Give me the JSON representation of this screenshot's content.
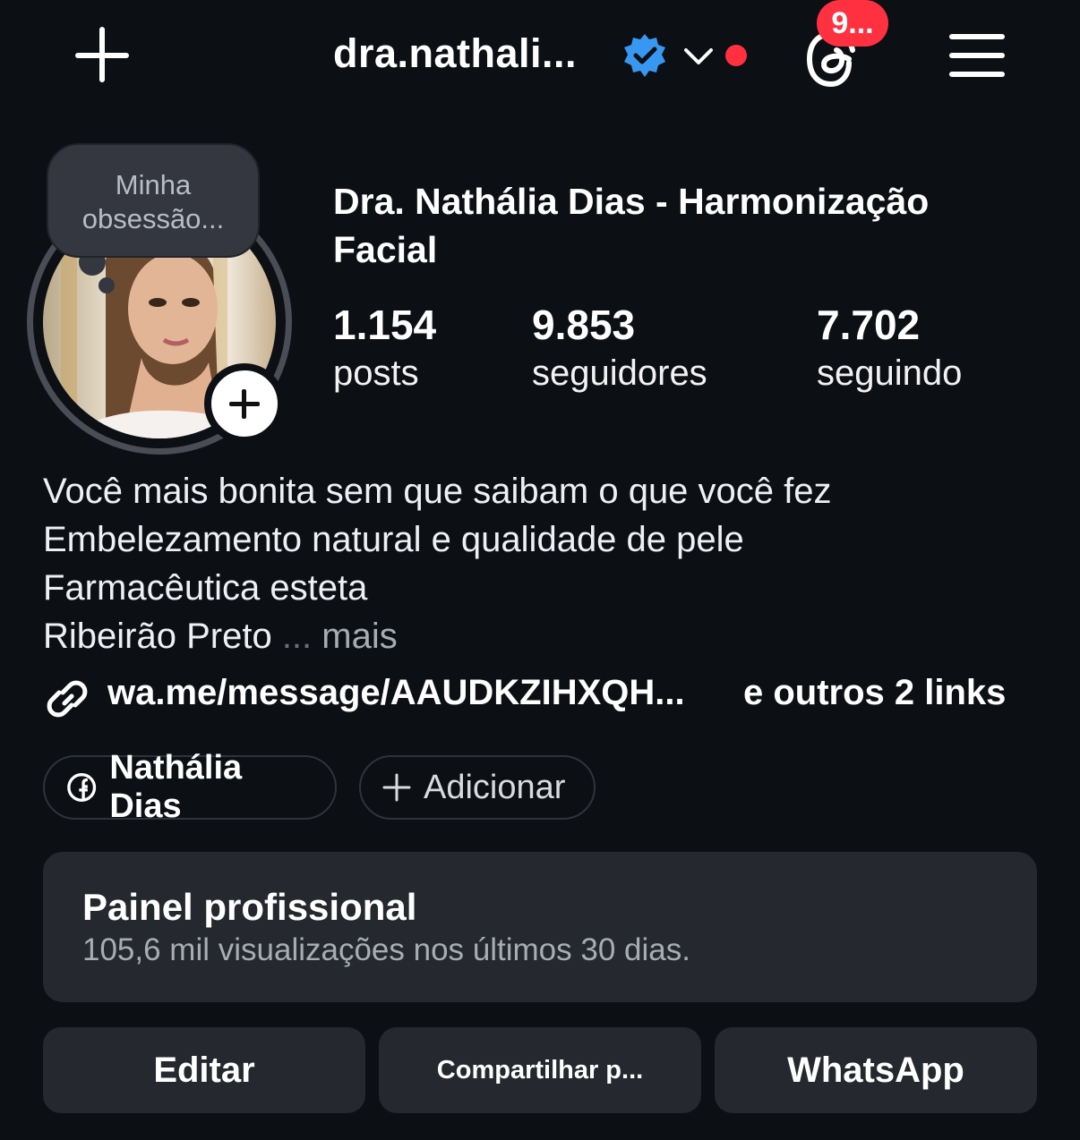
{
  "header": {
    "username": "dra.nathali...",
    "threads_badge": "9..."
  },
  "profile": {
    "note": "Minha obsessão...",
    "full_name": "Dra. Nathália Dias - Harmonização Facial",
    "stats": [
      {
        "value": "1.154",
        "label": "posts"
      },
      {
        "value": "9.853",
        "label": "seguidores"
      },
      {
        "value": "7.702",
        "label": "seguindo"
      }
    ],
    "bio_lines": [
      "Você mais bonita sem que saibam o que você fez",
      "Embelezamento natural e qualidade de pele",
      "Farmacêutica esteta",
      "Ribeirão Preto"
    ],
    "bio_ellipsis": "...",
    "bio_more": "mais",
    "link": "wa.me/message/AAUDKZIHXQH...",
    "link_extra": "e outros 2 links"
  },
  "chips": {
    "facebook": "Nathália Dias",
    "add": "Adicionar"
  },
  "pro_panel": {
    "title": "Painel profissional",
    "subtitle": "105,6 mil visualizações nos últimos 30 dias."
  },
  "actions": {
    "edit": "Editar",
    "share": "Compartilhar p...",
    "whatsapp": "WhatsApp"
  },
  "colors": {
    "background": "#0c0f14",
    "card": "#25282e",
    "badge_red": "#ff3040",
    "verified_blue": "#3897f0"
  },
  "icons": [
    "plus-icon",
    "verified-icon",
    "chevron-down-icon",
    "threads-icon",
    "menu-icon",
    "link-icon",
    "facebook-icon",
    "add-icon"
  ]
}
